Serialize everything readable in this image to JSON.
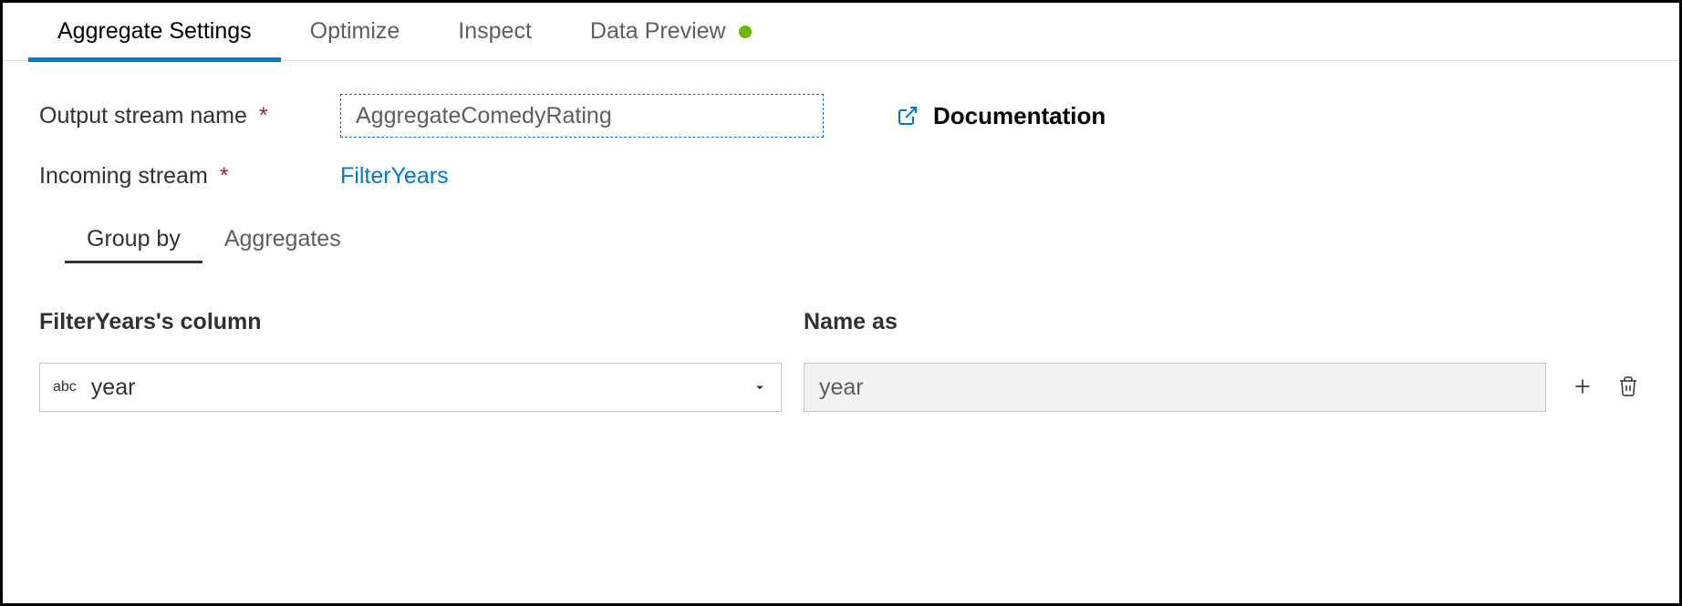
{
  "tabs": {
    "aggregate_settings": "Aggregate Settings",
    "optimize": "Optimize",
    "inspect": "Inspect",
    "data_preview": "Data Preview"
  },
  "fields": {
    "output_stream_label": "Output stream name",
    "output_stream_value": "AggregateComedyRating",
    "incoming_stream_label": "Incoming stream",
    "incoming_stream_value": "FilterYears",
    "documentation": "Documentation"
  },
  "sub_tabs": {
    "group_by": "Group by",
    "aggregates": "Aggregates"
  },
  "group_by": {
    "column_header": "FilterYears's column",
    "name_as_header": "Name as",
    "type_badge": "abc",
    "column_value": "year",
    "name_as_value": "year"
  }
}
